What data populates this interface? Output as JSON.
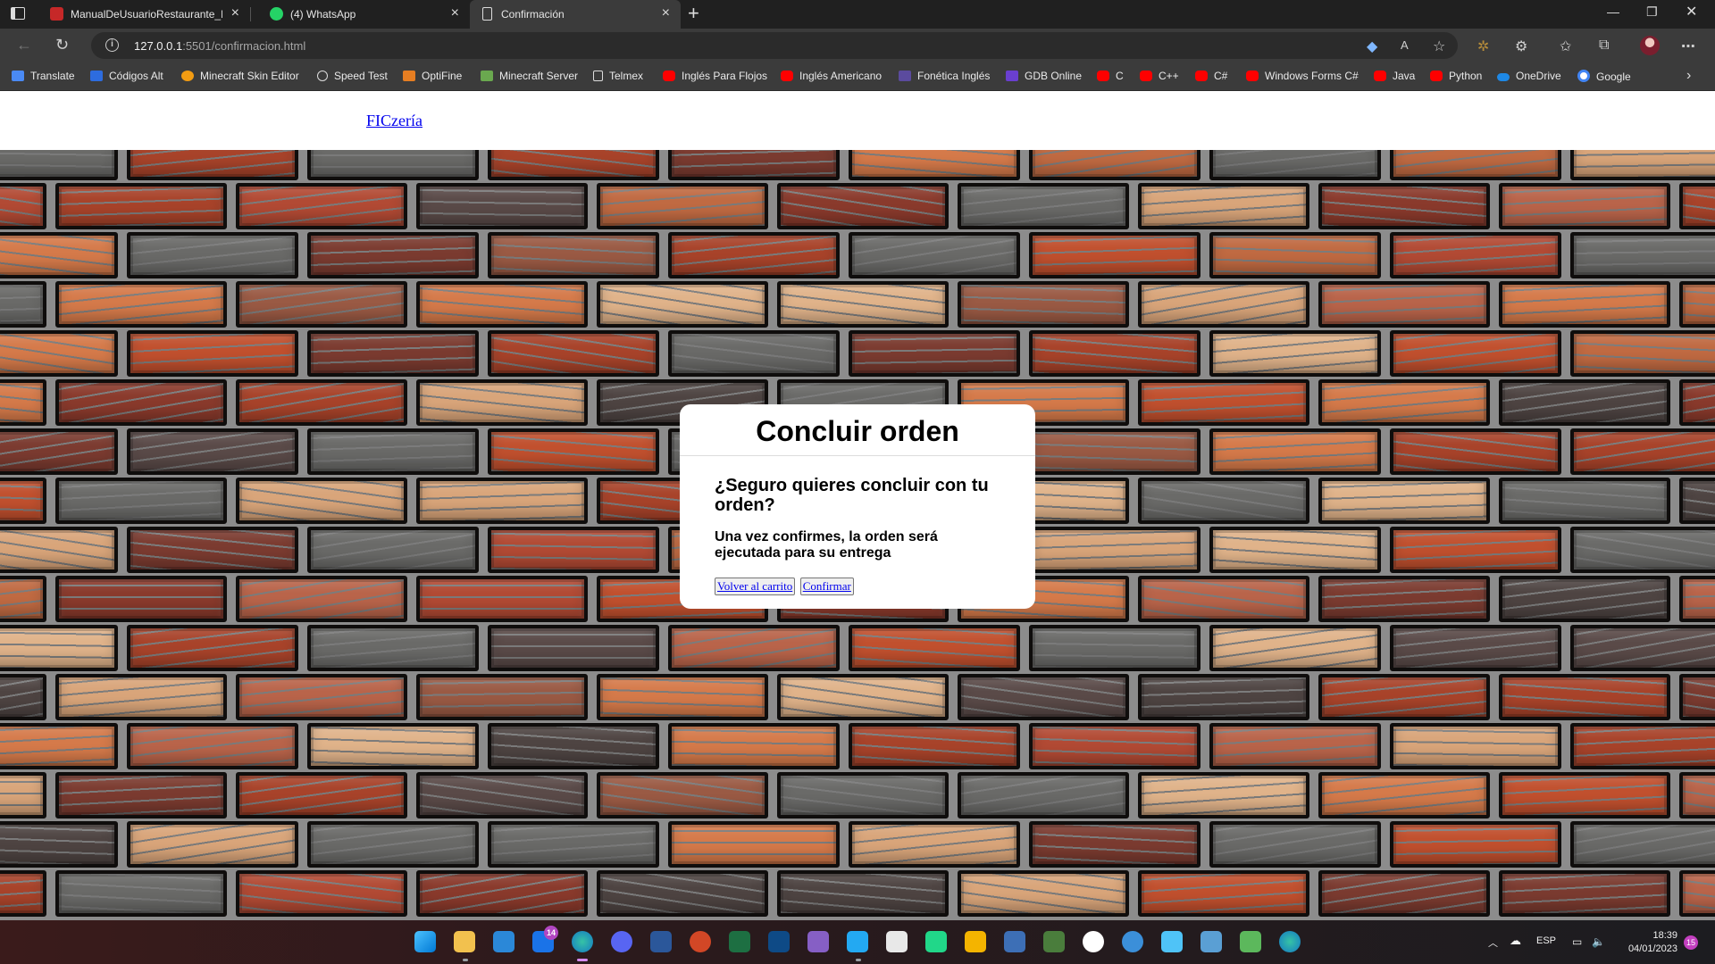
{
  "browser": {
    "tabs": [
      {
        "title": "ManualDeUsuarioRestaurante_Eq",
        "icon": "pdf-icon",
        "active": false
      },
      {
        "title": "(4) WhatsApp",
        "icon": "whatsapp-icon",
        "active": false
      },
      {
        "title": "Confirmación",
        "icon": "page-icon",
        "active": true
      }
    ],
    "address": {
      "host": "127.0.0.1",
      "rest": ":5501/confirmacion.html"
    },
    "bookmarks": [
      "Translate",
      "Códigos Alt",
      "Minecraft Skin Editor",
      "Speed Test",
      "OptiFine",
      "Minecraft Server",
      "Telmex",
      "Inglés Para Flojos",
      "Inglés Americano",
      "Fonética Inglés",
      "GDB Online",
      "C",
      "C++",
      "C#",
      "Windows Forms C#",
      "Java",
      "Python",
      "OneDrive",
      "Google"
    ]
  },
  "site": {
    "brand": "FICzería"
  },
  "dialog": {
    "title": "Concluir orden",
    "question": "¿Seguro quieres concluir con tu orden?",
    "note": "Una vez confirmes, la orden será ejecutada para su entrega",
    "back_label": "Volver al carrito",
    "confirm_label": "Confirmar"
  },
  "taskbar": {
    "mail_badge": "14",
    "language": "ESP",
    "time": "18:39",
    "date": "04/01/2023",
    "notifications": "15"
  },
  "colors": {
    "link": "#0000ee",
    "chrome_dark": "#202020",
    "chrome_mid": "#3b3b3b"
  }
}
